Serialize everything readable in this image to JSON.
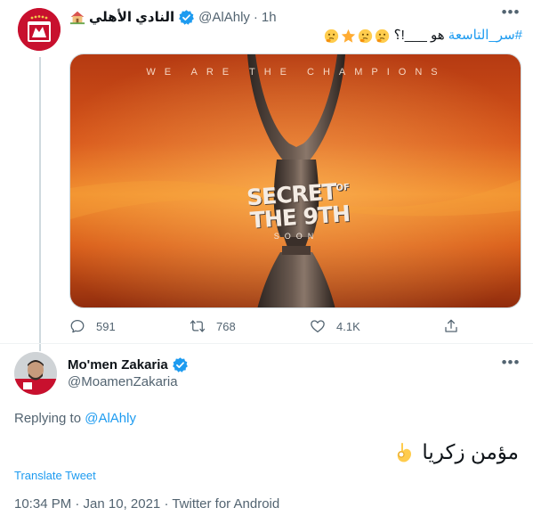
{
  "tweet": {
    "author_name": "النادي الأهلي",
    "handle": "@AlAhly",
    "separator": "·",
    "time": "1h",
    "more": "•••",
    "text_prefix": "هو ___!؟",
    "hashtag": "#سر_التاسعة",
    "emojis": [
      "thinking-face-emoji",
      "star-emoji",
      "thinking-face-emoji",
      "thinking-face-emoji"
    ],
    "media": {
      "top_text": "WE ARE THE CHAMPIONS",
      "title_line1": "SECRET",
      "title_of": "OF",
      "title_line2": "THE 9TH",
      "subtitle": "SOON"
    },
    "actions": {
      "replies": "591",
      "retweets": "768",
      "likes": "4.1K"
    }
  },
  "reply": {
    "author_name": "Mo'men Zakaria",
    "handle": "@MoamenZakaria",
    "more": "•••",
    "replying_prefix": "Replying to",
    "replying_mention": "@AlAhly",
    "text": "مؤمن زكريا",
    "emoji": "ok-hand-emoji",
    "translate": "Translate Tweet",
    "meta": "10:34 PM · Jan 10, 2021 · Twitter for Android"
  },
  "colors": {
    "accent": "#1d9bf0",
    "secondary_text": "#536471",
    "verified": "#1d9bf0",
    "ahly_red": "#c8102e"
  }
}
